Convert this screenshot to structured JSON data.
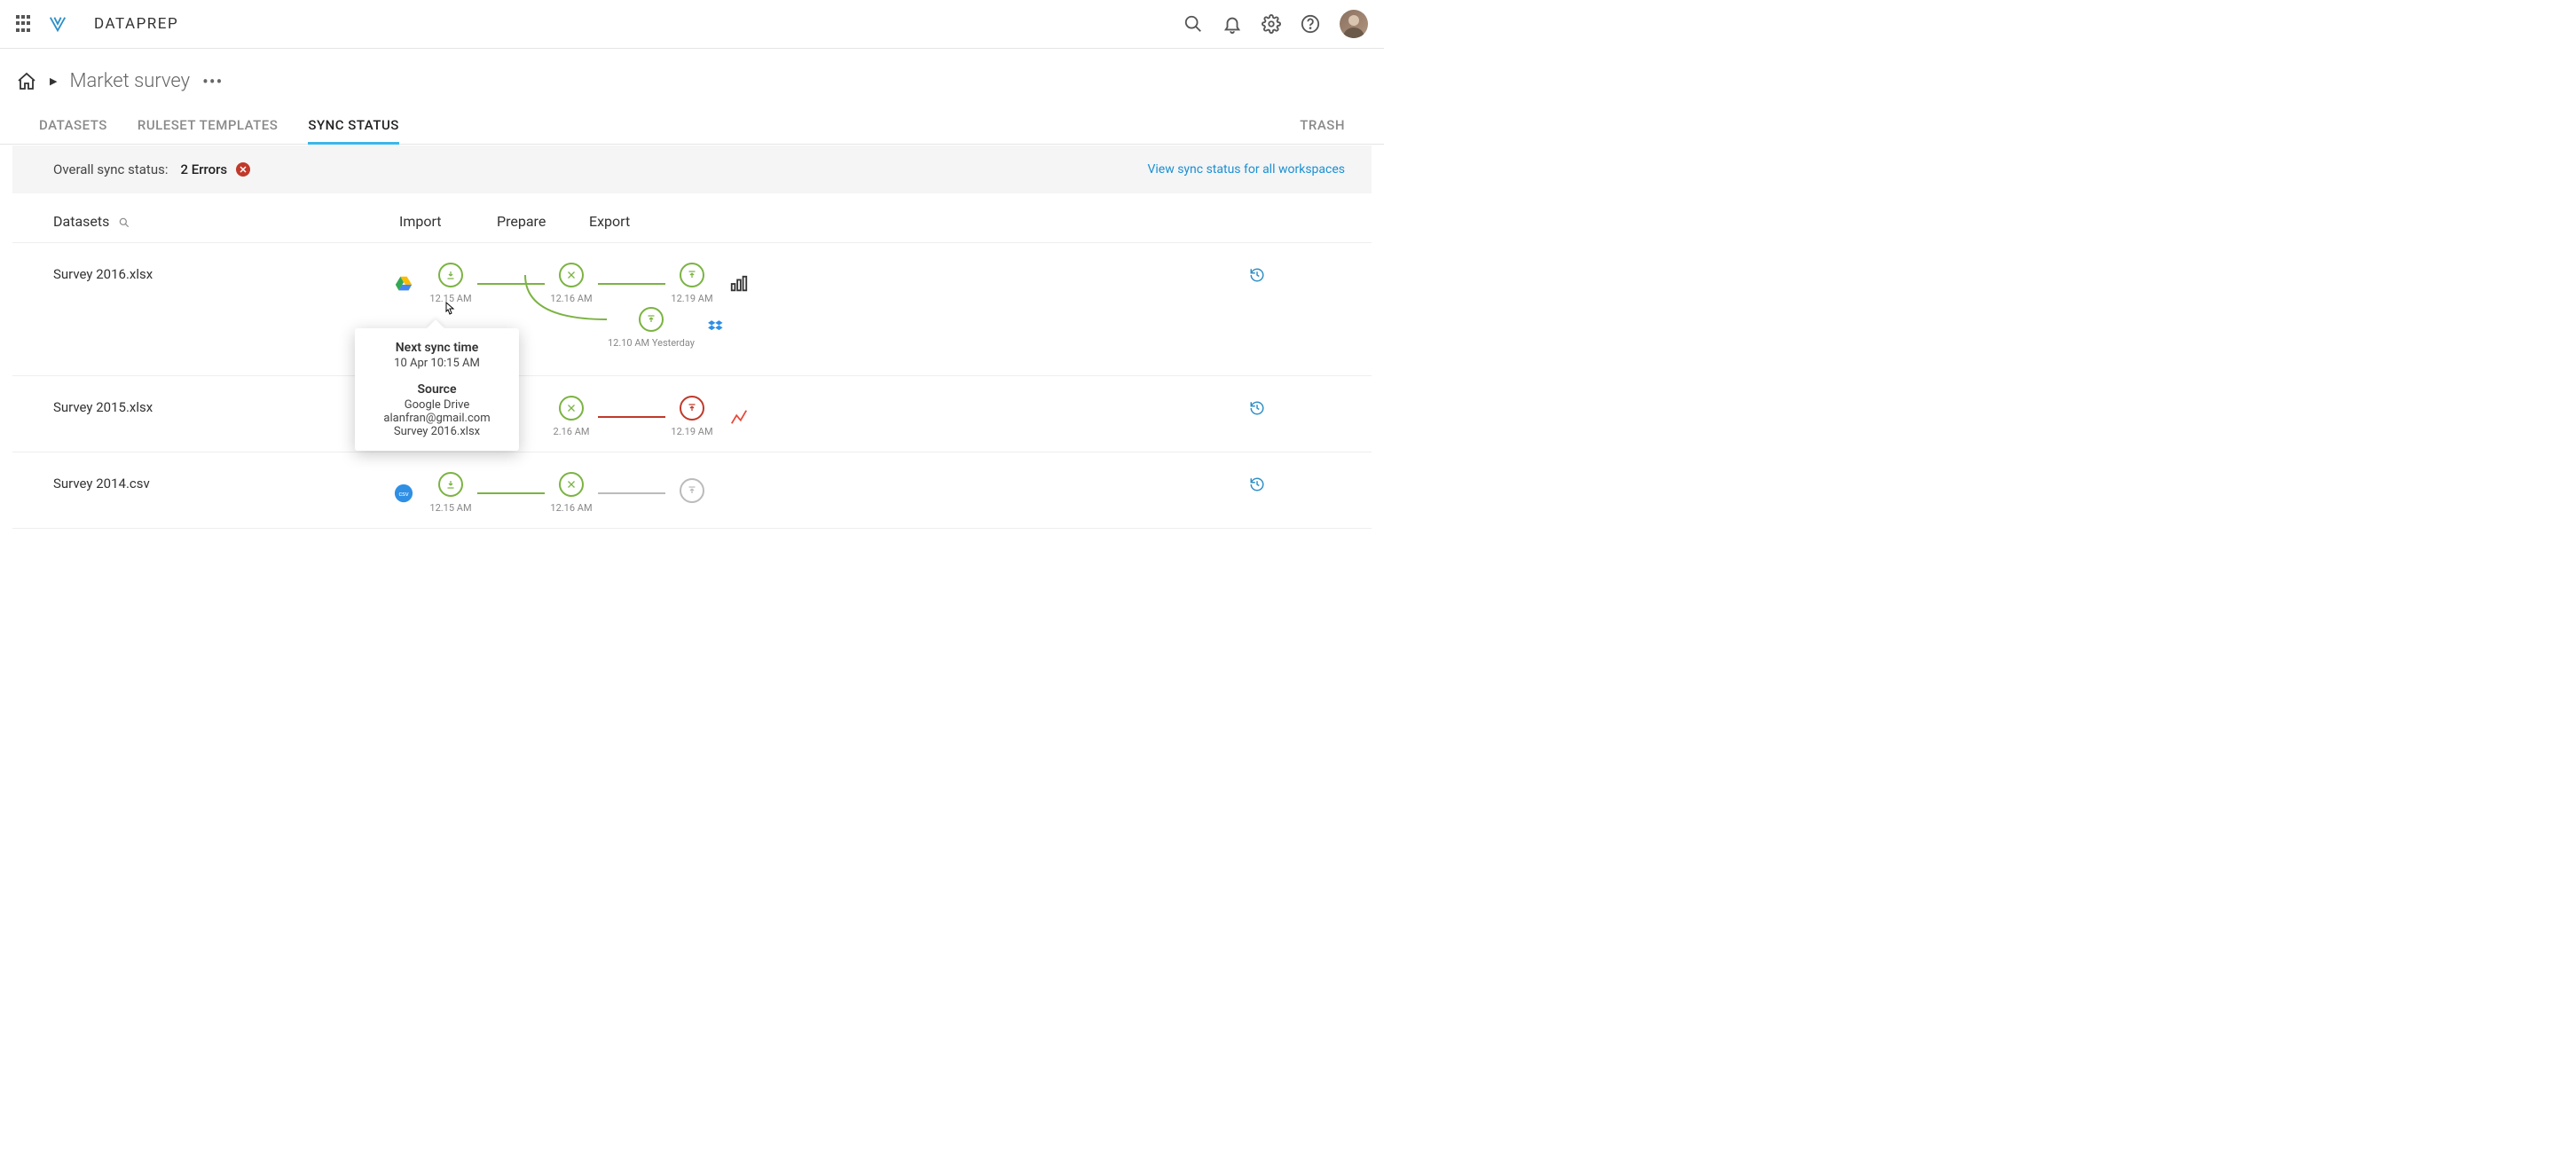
{
  "app": {
    "name": "DATAPREP"
  },
  "breadcrumb": {
    "title": "Market survey"
  },
  "tabs": {
    "datasets": "DATASETS",
    "ruleset": "RULESET TEMPLATES",
    "sync": "SYNC STATUS",
    "trash": "TRASH"
  },
  "status": {
    "label": "Overall sync status:",
    "value": "2 Errors",
    "link": "View sync status for all workspaces"
  },
  "columns": {
    "datasets": "Datasets",
    "import": "Import",
    "prepare": "Prepare",
    "export": "Export"
  },
  "rows": [
    {
      "name": "Survey 2016.xlsx",
      "source": "google-drive",
      "import_time": "12.15 AM",
      "prepare_time": "12.16 AM",
      "exports": [
        {
          "time": "12.19 AM",
          "dest": "powerbi",
          "status": "ok"
        },
        {
          "time": "12.10 AM Yesterday",
          "dest": "dropbox",
          "status": "ok"
        }
      ]
    },
    {
      "name": "Survey 2015.xlsx",
      "source": "google-drive",
      "import_time": "",
      "prepare_time": "2.16 AM",
      "exports": [
        {
          "time": "12.19 AM",
          "dest": "analytics",
          "status": "error"
        }
      ]
    },
    {
      "name": "Survey 2014.csv",
      "source": "csv",
      "import_time": "12.15 AM",
      "prepare_time": "12.16 AM",
      "exports": [
        {
          "time": "",
          "dest": "",
          "status": "pending"
        }
      ]
    }
  ],
  "popover": {
    "title1": "Next sync time",
    "time": "10 Apr 10:15 AM",
    "title2": "Source",
    "src_name": "Google Drive",
    "src_email": "alanfran@gmail.com",
    "src_file": "Survey 2016.xlsx"
  }
}
